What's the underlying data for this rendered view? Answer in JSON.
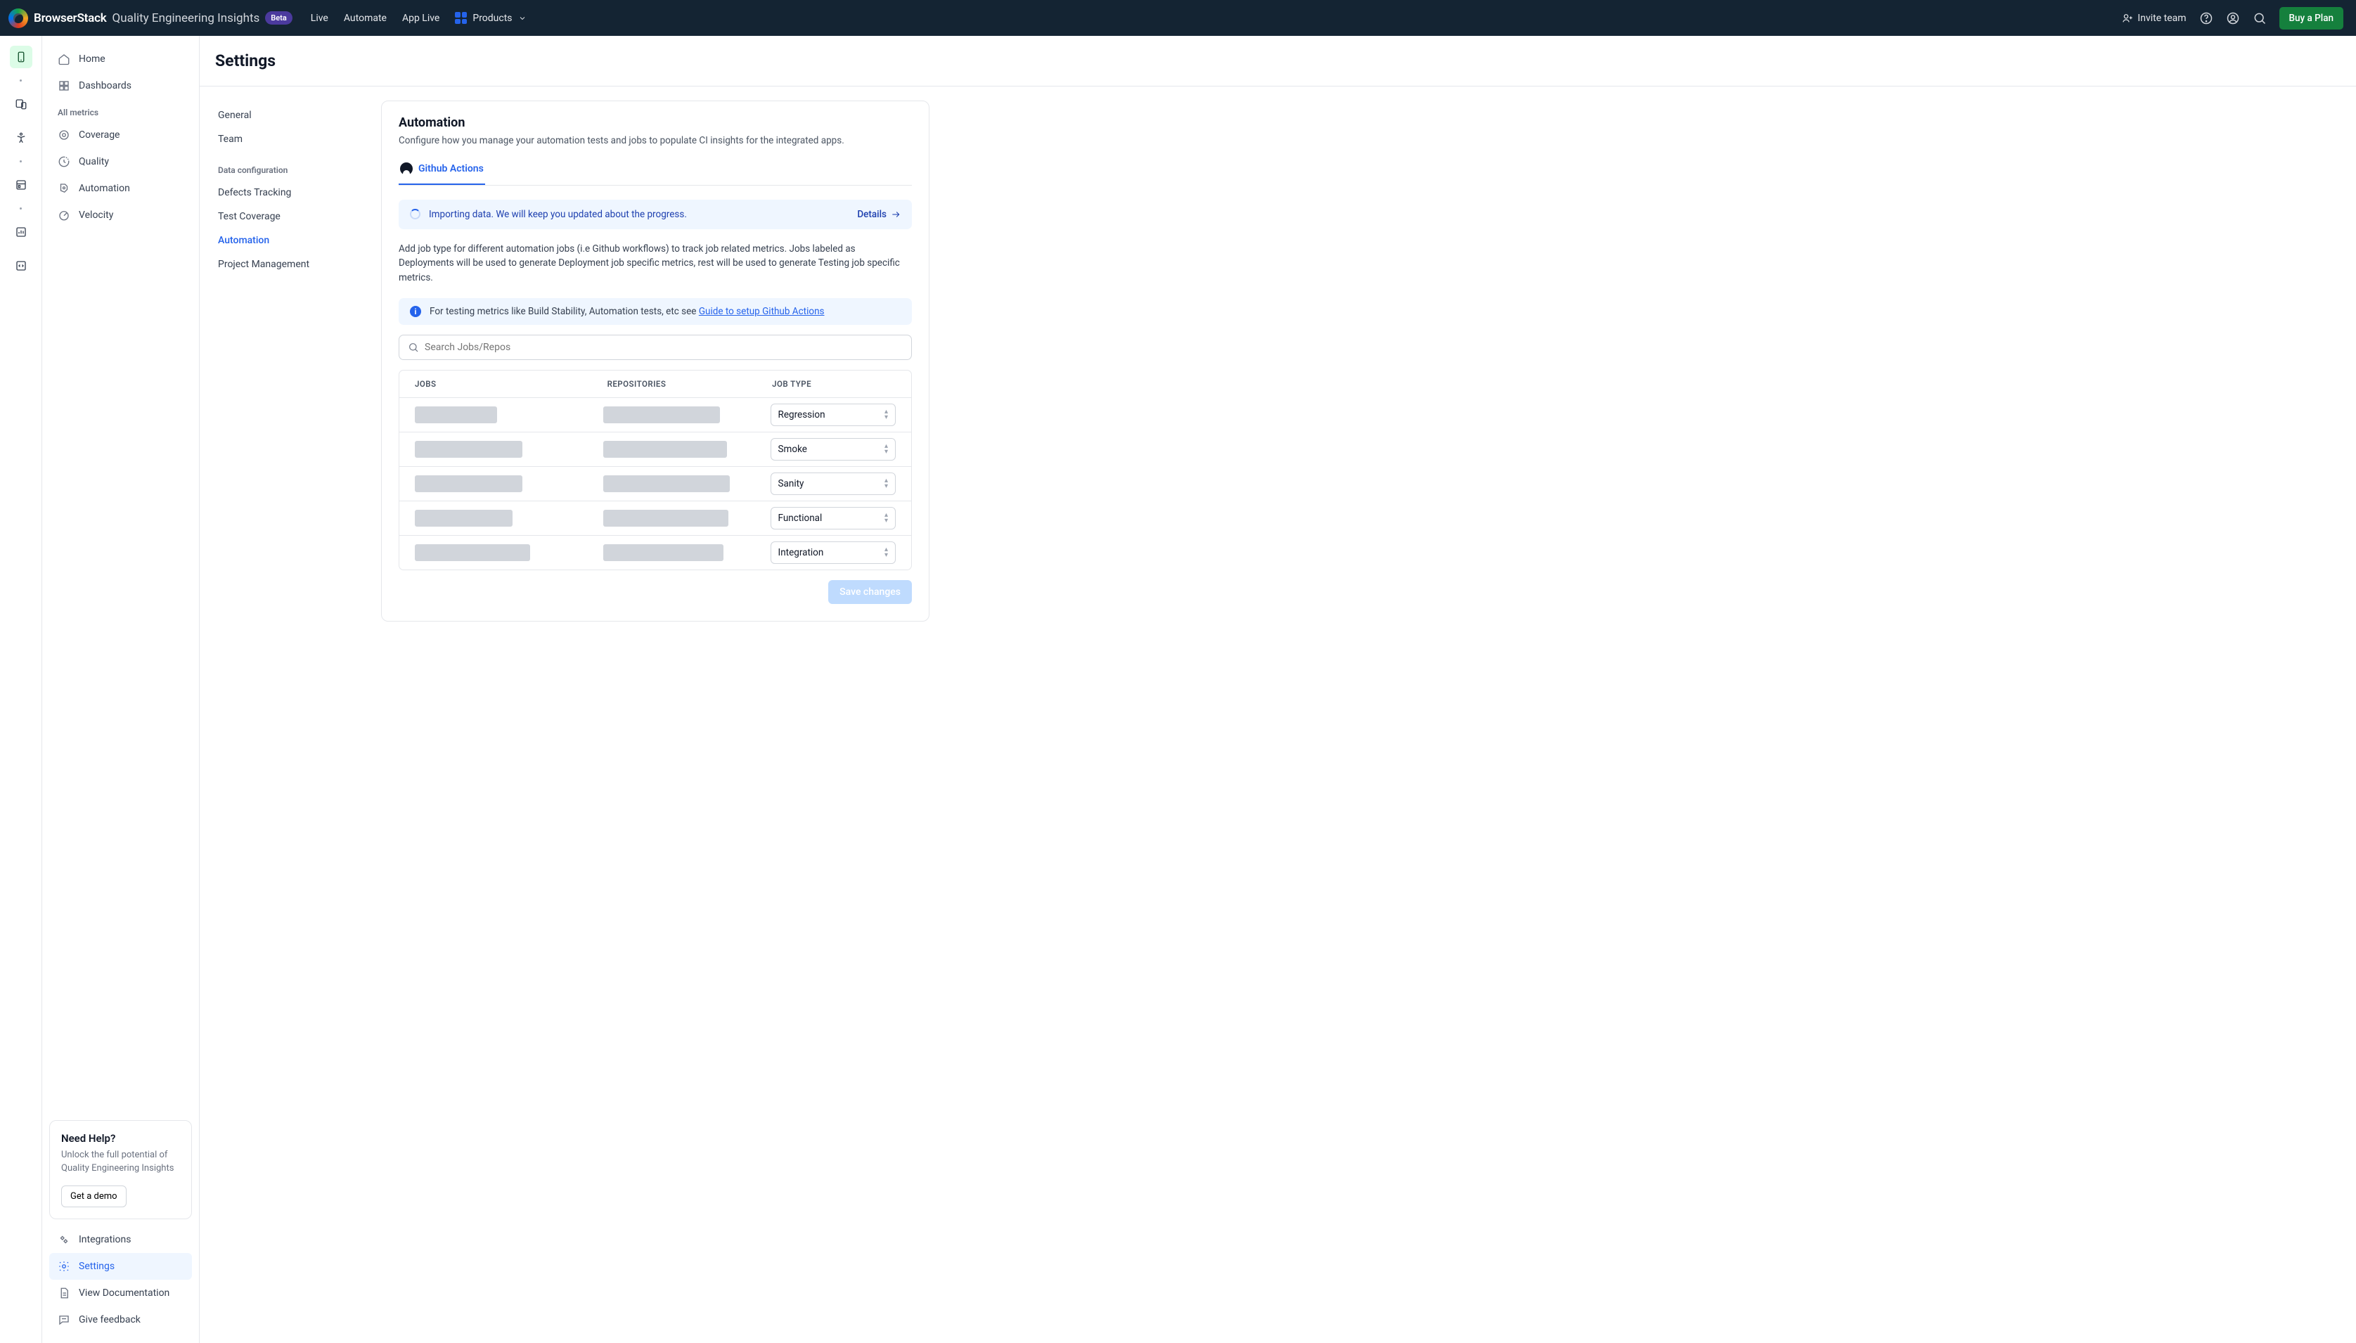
{
  "header": {
    "brand": "BrowserStack",
    "product_suffix": "Quality Engineering Insights",
    "beta": "Beta",
    "links": [
      "Live",
      "Automate",
      "App Live"
    ],
    "products_label": "Products",
    "invite_team": "Invite team",
    "buy_plan": "Buy a Plan"
  },
  "sidebar": {
    "top": [
      {
        "label": "Home"
      },
      {
        "label": "Dashboards"
      }
    ],
    "section_label": "All metrics",
    "metrics": [
      {
        "label": "Coverage"
      },
      {
        "label": "Quality"
      },
      {
        "label": "Automation"
      },
      {
        "label": "Velocity"
      }
    ],
    "help": {
      "title": "Need Help?",
      "body": "Unlock the full potential of Quality Engineering Insights",
      "cta": "Get a demo"
    },
    "bottom": [
      {
        "label": "Integrations"
      },
      {
        "label": "Settings",
        "active": true
      },
      {
        "label": "View Documentation"
      },
      {
        "label": "Give feedback"
      }
    ]
  },
  "page": {
    "title": "Settings"
  },
  "settings_nav": {
    "items_a": [
      {
        "label": "General"
      },
      {
        "label": "Team"
      }
    ],
    "section_label": "Data configuration",
    "items_b": [
      {
        "label": "Defects Tracking"
      },
      {
        "label": "Test Coverage"
      },
      {
        "label": "Automation",
        "active": true
      },
      {
        "label": "Project Management"
      }
    ]
  },
  "panel": {
    "title": "Automation",
    "description": "Configure how you manage your automation tests and jobs to populate CI insights for the integrated apps.",
    "tab_label": "Github Actions",
    "import_notice": "Importing data. We will keep you updated about the progress.",
    "details_label": "Details",
    "body_text": "Add job type for different automation jobs (i.e Github workflows) to track job related metrics. Jobs labeled as Deployments will be used to generate Deployment job specific metrics, rest will be used to generate Testing job specific metrics.",
    "guide_prefix": "For testing metrics like Build Stability, Automation tests, etc see  ",
    "guide_link": "Guide to setup Github Actions",
    "search_placeholder": "Search Jobs/Repos",
    "columns": {
      "jobs": "JOBS",
      "repos": "REPOSITORIES",
      "job_type": "JOB TYPE"
    },
    "rows": [
      {
        "job_type": "Regression"
      },
      {
        "job_type": "Smoke"
      },
      {
        "job_type": "Sanity"
      },
      {
        "job_type": "Functional"
      },
      {
        "job_type": "Integration"
      }
    ],
    "save_label": "Save changes"
  }
}
